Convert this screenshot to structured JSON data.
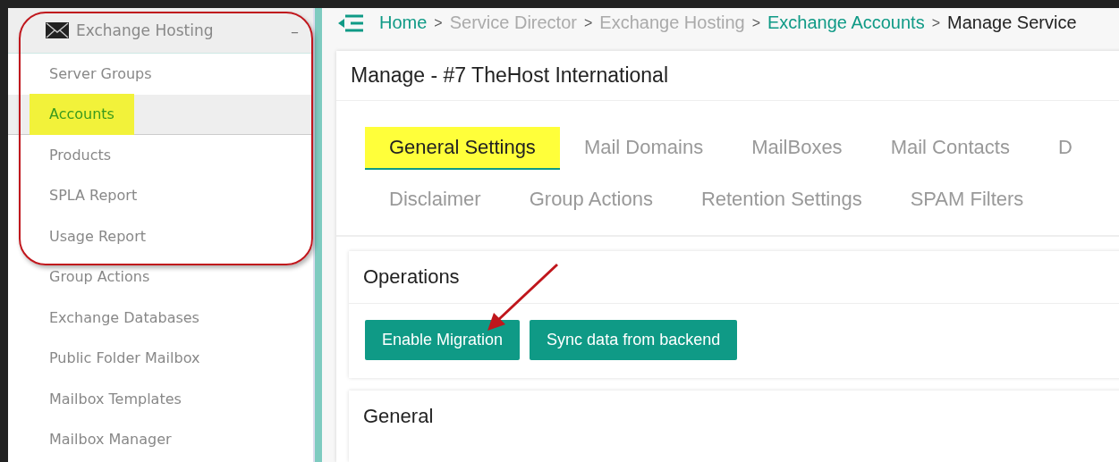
{
  "sidebar": {
    "header": {
      "title": "Exchange Hosting",
      "toggle": "–",
      "expanded": true
    },
    "items": [
      {
        "label": "Server Groups",
        "selected": false,
        "highlighted": false
      },
      {
        "label": "Accounts",
        "selected": true,
        "highlighted": true
      },
      {
        "label": "Products",
        "selected": false,
        "highlighted": false
      },
      {
        "label": "SPLA Report",
        "selected": false,
        "highlighted": false
      },
      {
        "label": "Usage Report",
        "selected": false,
        "highlighted": false
      },
      {
        "label": "Group Actions",
        "selected": false,
        "highlighted": false
      },
      {
        "label": "Exchange Databases",
        "selected": false,
        "highlighted": false
      },
      {
        "label": "Public Folder Mailbox",
        "selected": false,
        "highlighted": false
      },
      {
        "label": "Mailbox Templates",
        "selected": false,
        "highlighted": false
      },
      {
        "label": "Mailbox Manager",
        "selected": false,
        "highlighted": false
      }
    ]
  },
  "breadcrumb": [
    {
      "label": "Home",
      "kind": "link"
    },
    {
      "label": ">",
      "kind": "separator"
    },
    {
      "label": "Service Director",
      "kind": "muted"
    },
    {
      "label": ">",
      "kind": "separator"
    },
    {
      "label": "Exchange Hosting",
      "kind": "muted"
    },
    {
      "label": ">",
      "kind": "separator"
    },
    {
      "label": "Exchange Accounts",
      "kind": "link"
    },
    {
      "label": ">",
      "kind": "separator"
    },
    {
      "label": "Manage Service",
      "kind": "current"
    }
  ],
  "page_title": "Manage - #7 TheHost International",
  "tab_rows": [
    [
      {
        "label": "General Settings",
        "selected": true,
        "highlighted": true
      },
      {
        "label": "Mail Domains",
        "selected": false,
        "highlighted": false
      },
      {
        "label": "MailBoxes",
        "selected": false,
        "highlighted": false
      },
      {
        "label": "Mail Contacts",
        "selected": false,
        "highlighted": false
      },
      {
        "label": "D",
        "selected": false,
        "highlighted": false
      }
    ],
    [
      {
        "label": "Disclaimer",
        "selected": false,
        "highlighted": false
      },
      {
        "label": "Group Actions",
        "selected": false,
        "highlighted": false
      },
      {
        "label": "Retention Settings",
        "selected": false,
        "highlighted": false
      },
      {
        "label": "SPAM Filters",
        "selected": false,
        "highlighted": false
      }
    ]
  ],
  "operations": {
    "title": "Operations",
    "buttons": [
      "Enable Migration",
      "Sync data from backend"
    ]
  },
  "general": {
    "title": "General"
  },
  "annotations": {
    "outline": true,
    "arrow": true
  }
}
